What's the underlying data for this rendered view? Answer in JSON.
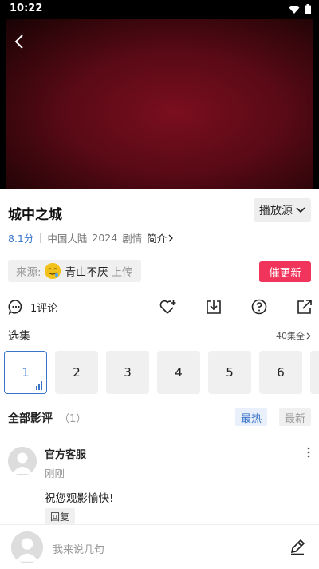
{
  "status_bar": {
    "time": "10:22"
  },
  "show": {
    "title": "城中之城",
    "score": "8.1分",
    "region": "中国大陆",
    "year": "2024",
    "genre": "剧情",
    "intro_label": "简介",
    "source_label": "播放源"
  },
  "uploader": {
    "prefix": "来源:",
    "name": "青山不厌",
    "suffix": "上传",
    "urge_label": "催更新"
  },
  "actions": {
    "comment_count": "1评论"
  },
  "episodes": {
    "title": "选集",
    "all_label": "40集全",
    "items": [
      "1",
      "2",
      "3",
      "4",
      "5",
      "6"
    ]
  },
  "reviews": {
    "title": "全部影评",
    "count": "（1）",
    "sort_hot": "最热",
    "sort_new": "最新",
    "items": [
      {
        "name": "官方客服",
        "time": "刚刚",
        "text": "祝您观影愉快!",
        "reply_label": "回复"
      }
    ]
  },
  "input": {
    "placeholder": "我来说几句"
  },
  "colors": {
    "accent": "#3a74c9",
    "urge": "#f0345c",
    "video_bg": "#6b0c1b"
  }
}
